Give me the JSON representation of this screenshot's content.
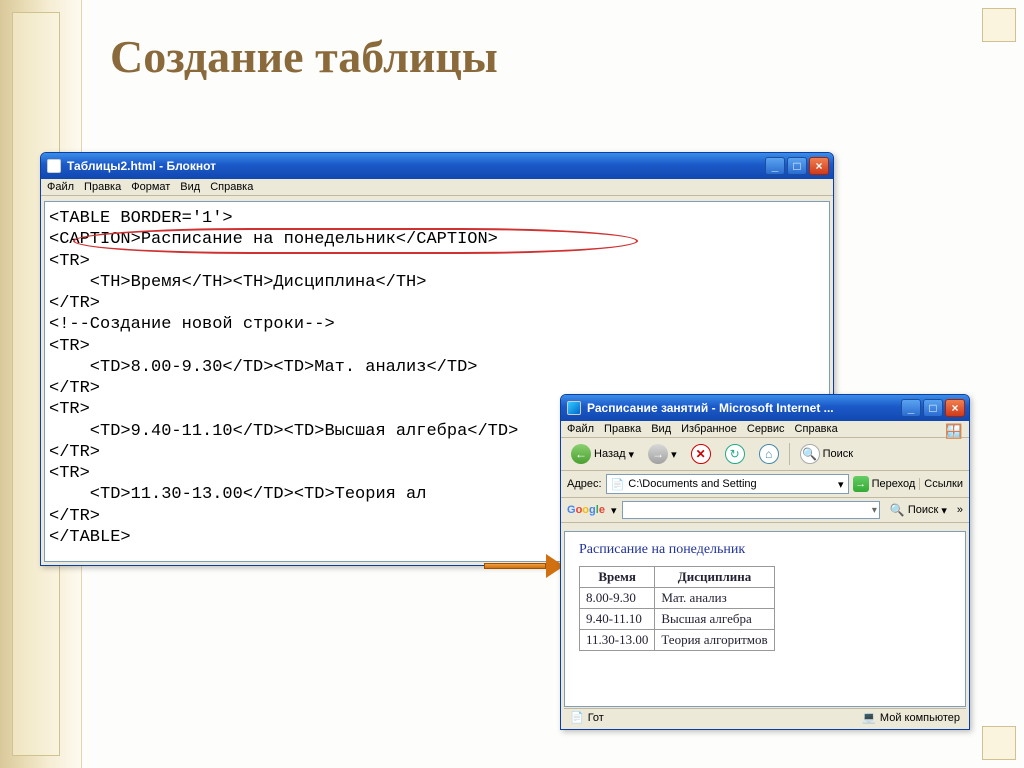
{
  "slide": {
    "title": "Создание таблицы"
  },
  "notepad": {
    "title": "Таблицы2.html - Блокнот",
    "menu": {
      "file": "Файл",
      "edit": "Правка",
      "format": "Формат",
      "view": "Вид",
      "help": "Справка"
    },
    "code": "<TABLE BORDER='1'>\n<CAPTION>Расписание на понедельник</CAPTION>\n<TR>\n    <TH>Время</TH><TH>Дисциплина</TH>\n</TR>\n<!--Создание новой строки-->\n<TR>\n    <TD>8.00-9.30</TD><TD>Мат. анализ</TD>\n</TR>\n<TR>\n    <TD>9.40-11.10</TD><TD>Высшая алгебра</TD>\n</TR>\n<TR>\n    <TD>11.30-13.00</TD><TD>Теория ал\n</TR>\n</TABLE>"
  },
  "ie": {
    "title": "Расписание занятий - Microsoft Internet ...",
    "menu": {
      "file": "Файл",
      "edit": "Правка",
      "view": "Вид",
      "favorites": "Избранное",
      "tools": "Сервис",
      "help": "Справка"
    },
    "toolbar": {
      "back": "Назад",
      "search": "Поиск",
      "addressLabel": "Адрес:",
      "addressValue": "C:\\Documents and Setting",
      "go": "Переход",
      "links": "Ссылки"
    },
    "google": {
      "logo": "Google",
      "searchBtn": "Поиск"
    },
    "page": {
      "caption": "Расписание на понедельник",
      "headers": [
        "Время",
        "Дисциплина"
      ],
      "rows": [
        [
          "8.00-9.30",
          "Мат. анализ"
        ],
        [
          "9.40-11.10",
          "Высшая алгебра"
        ],
        [
          "11.30-13.00",
          "Теория алгоритмов"
        ]
      ]
    },
    "status": {
      "left": "Гот",
      "right": "Мой компьютер"
    }
  }
}
